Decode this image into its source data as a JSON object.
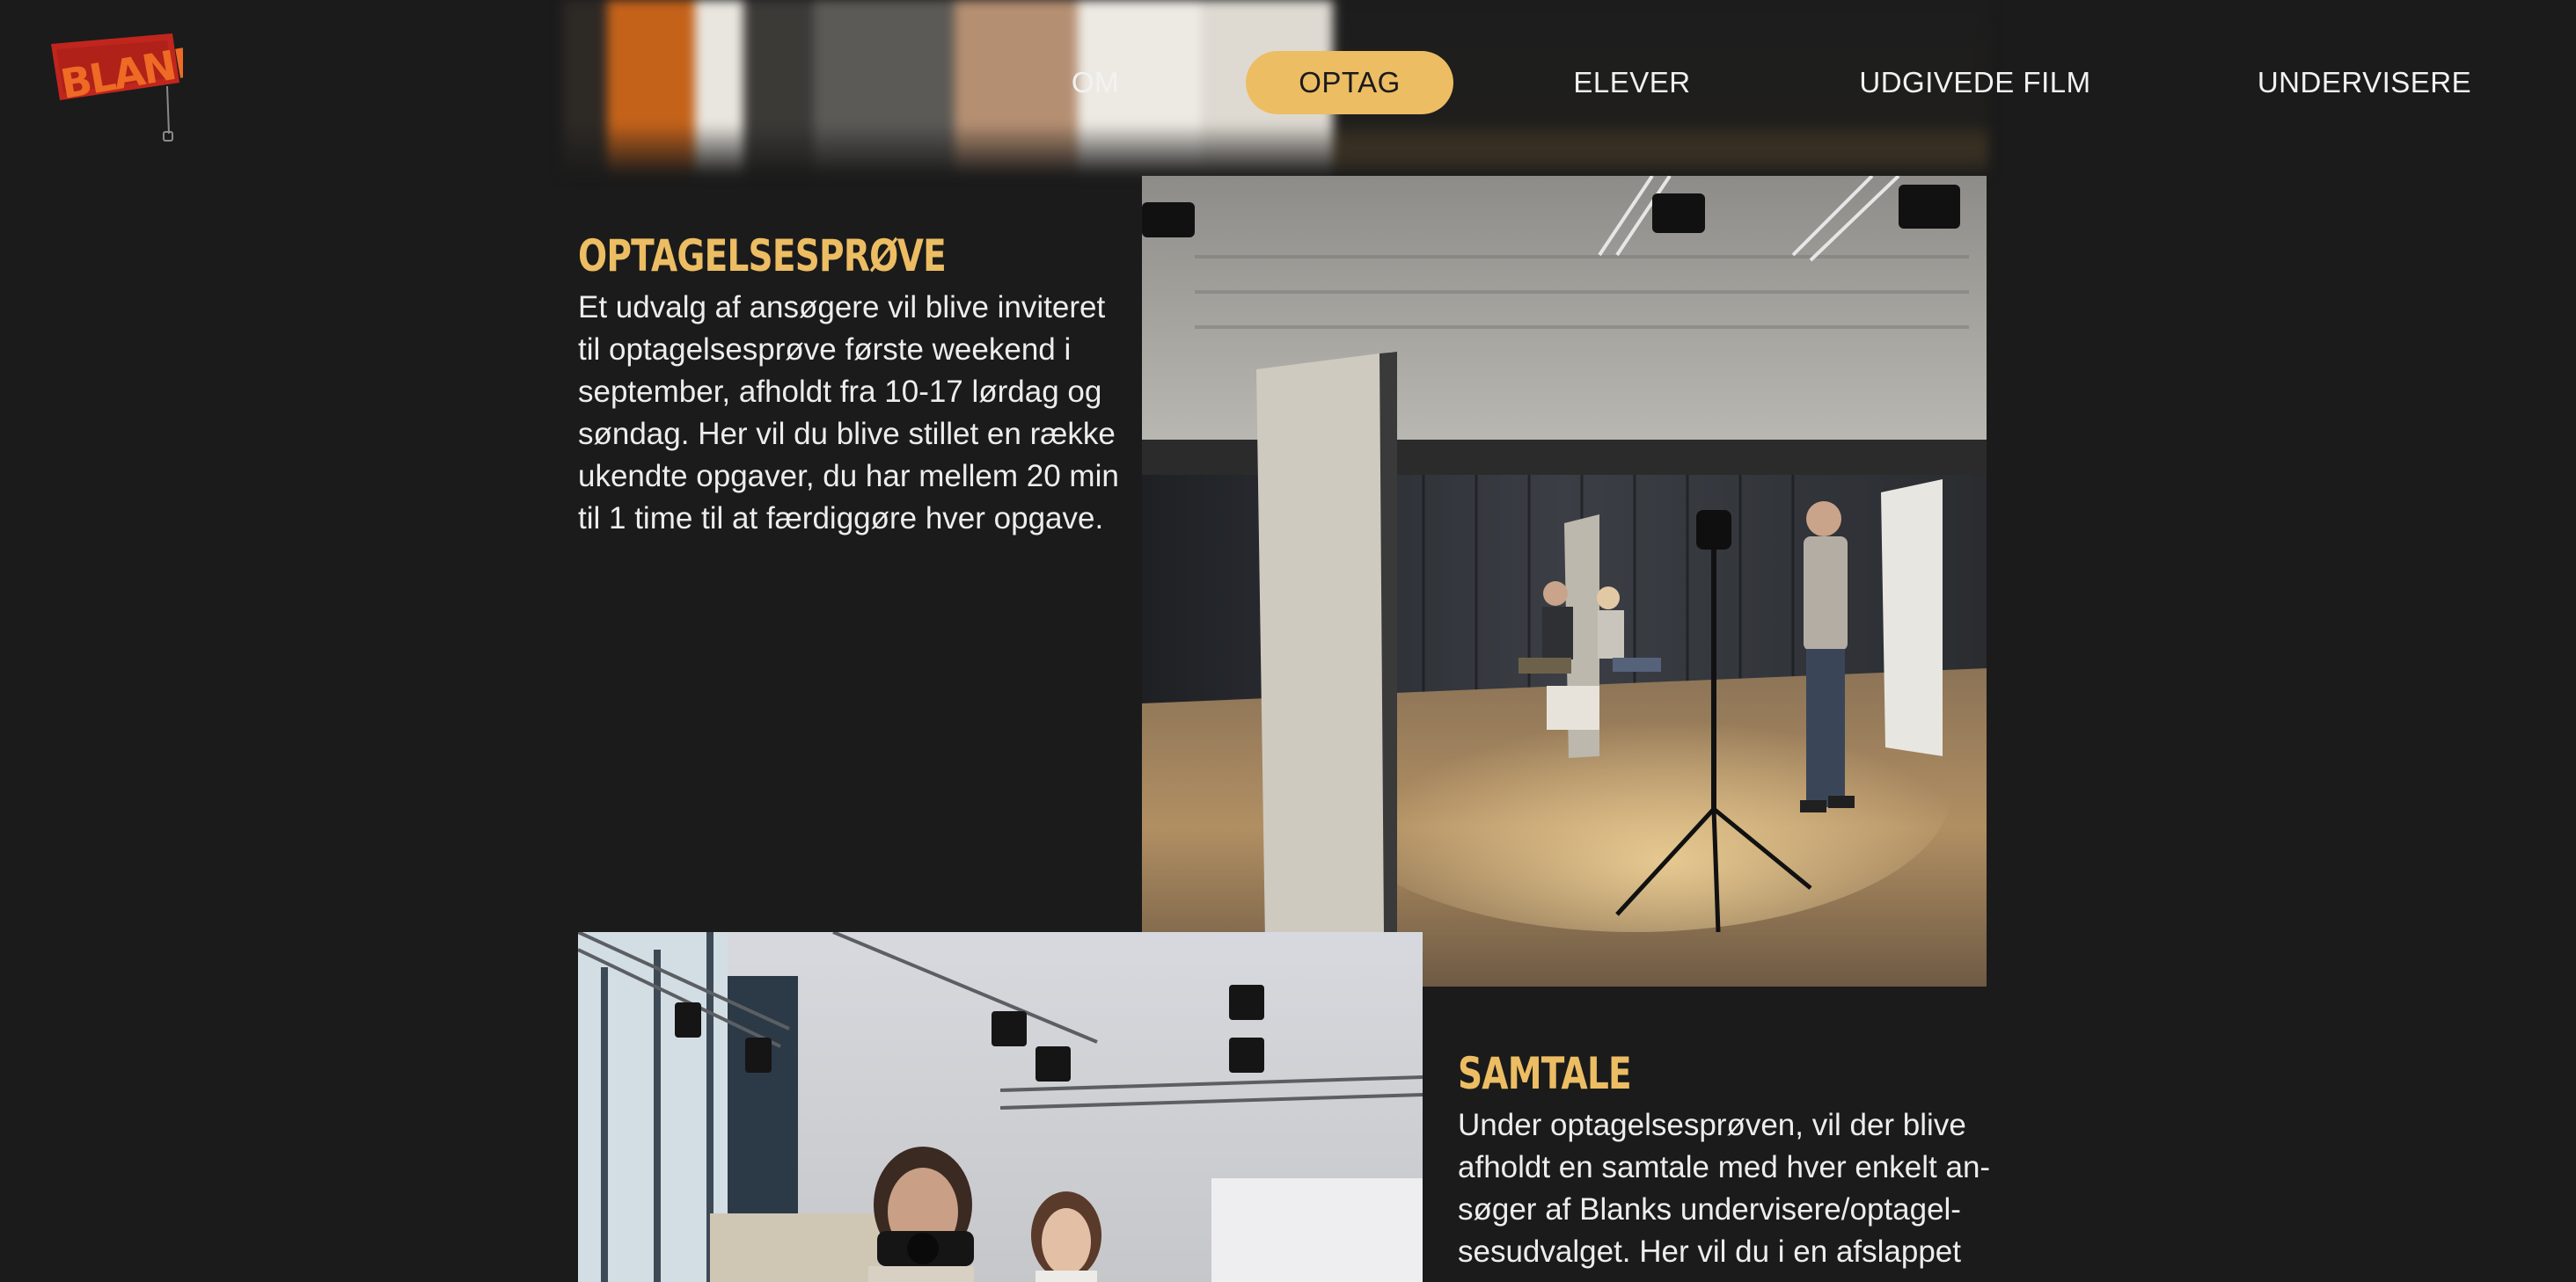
{
  "logo": {
    "text": "BLANK"
  },
  "nav": {
    "items": [
      {
        "label": "OM",
        "active": false
      },
      {
        "label": "OPTAG",
        "active": true
      },
      {
        "label": "ELEVER",
        "active": false
      },
      {
        "label": "UDGIVEDE FILM",
        "active": false
      },
      {
        "label": "UNDERVISERE",
        "active": false
      }
    ]
  },
  "sections": [
    {
      "heading": "OPTAGELSESPRØVE",
      "body": "Et udvalg af ansøgere vil blive inviteret til optagelsesprøve første weekend i september, afholdt fra 10-17 lørdag og søndag. Her vil du blive stillet en række ukendte opgaver, du har mellem 20 min til 1 time til at færdiggøre hver opgave."
    },
    {
      "heading": "SAMTALE",
      "body": "Under optagelsesprøven, vil der blive afholdt en samtale med hver enkelt an-søger af Blanks undervisere/optagel-sesudvalget. Her vil du i en afslappet"
    }
  ],
  "colors": {
    "background": "#1b1b1b",
    "accent": "#ecbd63",
    "text": "#ededed",
    "logo_red": "#c0261d"
  }
}
